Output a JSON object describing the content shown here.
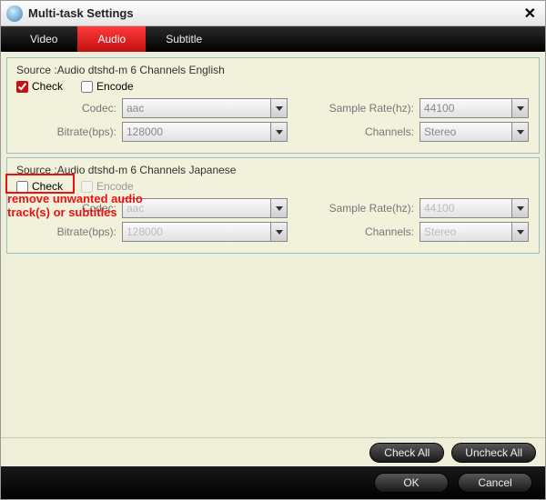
{
  "window": {
    "title": "Multi-task Settings"
  },
  "tabs": {
    "video": "Video",
    "audio": "Audio",
    "subtitle": "Subtitle"
  },
  "labels": {
    "check": "Check",
    "encode": "Encode",
    "codec": "Codec:",
    "samplerate": "Sample Rate(hz):",
    "bitrate": "Bitrate(bps):",
    "channels": "Channels:"
  },
  "tracks": [
    {
      "source": "Source :Audio  dtshd-m  6 Channels  English",
      "checked": true,
      "encode": false,
      "codec": "aac",
      "samplerate": "44100",
      "bitrate": "128000",
      "channels": "Stereo"
    },
    {
      "source": "Source :Audio  dtshd-m  6 Channels  Japanese",
      "checked": false,
      "encode": false,
      "codec": "aac",
      "samplerate": "44100",
      "bitrate": "128000",
      "channels": "Stereo"
    }
  ],
  "annotation": "remove unwanted audio track(s) or subtitles",
  "buttons": {
    "check_all": "Check All",
    "uncheck_all": "Uncheck All",
    "ok": "OK",
    "cancel": "Cancel"
  }
}
